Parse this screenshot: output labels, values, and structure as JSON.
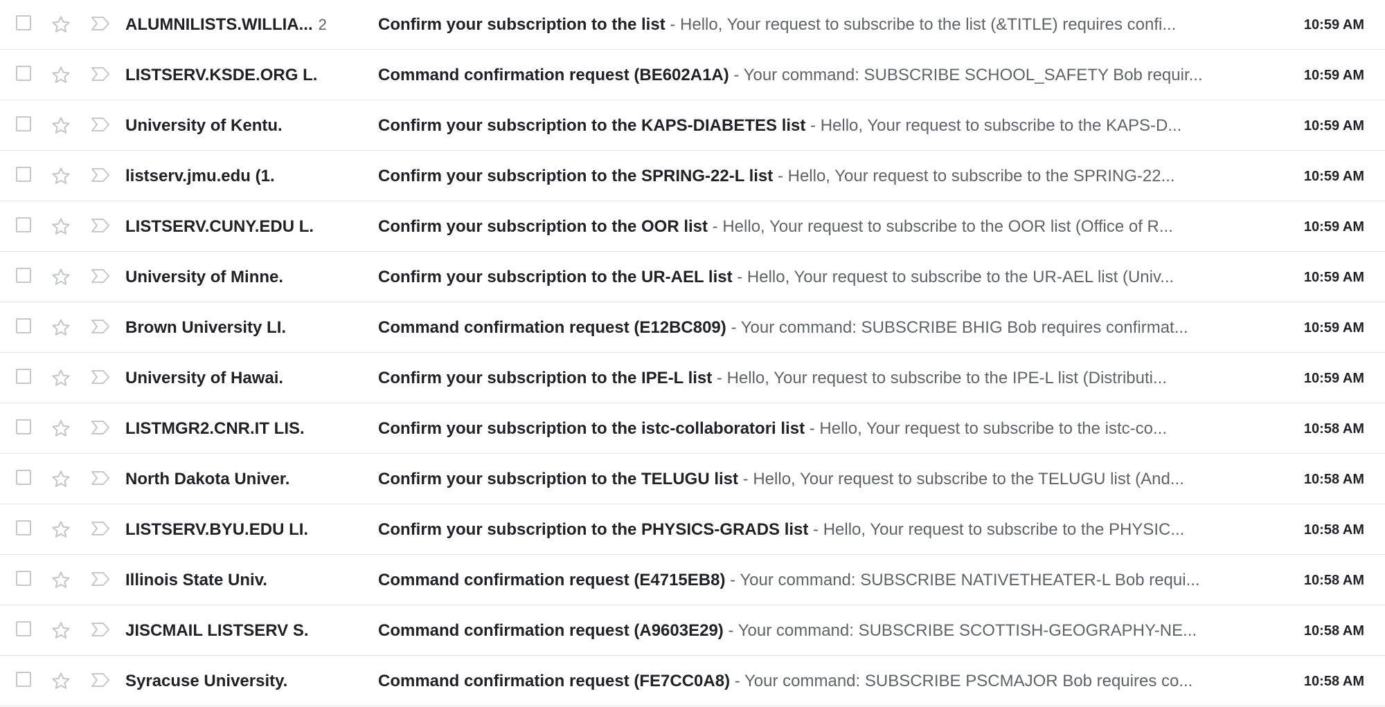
{
  "colors": {
    "text_primary": "#202124",
    "text_secondary": "#5f6368",
    "divider": "#e3e4e6",
    "icon_outline": "#c4c7cc"
  },
  "icons": {
    "checkbox": "checkbox-icon",
    "star": "star-icon",
    "important": "important-marker-icon"
  },
  "separator": " - ",
  "emails": [
    {
      "sender": "ALUMNILISTS.WILLIA...",
      "count": "2",
      "subject": "Confirm your subscription to the list",
      "snippet": "Hello, Your request to subscribe to the list (&TITLE) requires confi...",
      "time": "10:59 AM"
    },
    {
      "sender": "LISTSERV.KSDE.ORG L.",
      "count": "",
      "subject": "Command confirmation request (BE602A1A)",
      "snippet": "Your command: SUBSCRIBE SCHOOL_SAFETY Bob requir...",
      "time": "10:59 AM"
    },
    {
      "sender": "University of Kentu.",
      "count": "",
      "subject": "Confirm your subscription to the KAPS-DIABETES list",
      "snippet": "Hello, Your request to subscribe to the KAPS-D...",
      "time": "10:59 AM"
    },
    {
      "sender": "listserv.jmu.edu (1.",
      "count": "",
      "subject": "Confirm your subscription to the SPRING-22-L list",
      "snippet": "Hello, Your request to subscribe to the SPRING-22...",
      "time": "10:59 AM"
    },
    {
      "sender": "LISTSERV.CUNY.EDU L.",
      "count": "",
      "subject": "Confirm your subscription to the OOR list",
      "snippet": "Hello, Your request to subscribe to the OOR list (Office of R...",
      "time": "10:59 AM"
    },
    {
      "sender": "University of Minne.",
      "count": "",
      "subject": "Confirm your subscription to the UR-AEL list",
      "snippet": "Hello, Your request to subscribe to the UR-AEL list (Univ...",
      "time": "10:59 AM"
    },
    {
      "sender": "Brown University LI.",
      "count": "",
      "subject": "Command confirmation request (E12BC809)",
      "snippet": "Your command: SUBSCRIBE BHIG Bob requires confirmat...",
      "time": "10:59 AM"
    },
    {
      "sender": "University of Hawai.",
      "count": "",
      "subject": "Confirm your subscription to the IPE-L list",
      "snippet": "Hello, Your request to subscribe to the IPE-L list (Distributi...",
      "time": "10:59 AM"
    },
    {
      "sender": "LISTMGR2.CNR.IT LIS.",
      "count": "",
      "subject": "Confirm your subscription to the istc-collaboratori list",
      "snippet": "Hello, Your request to subscribe to the istc-co...",
      "time": "10:58 AM"
    },
    {
      "sender": "North Dakota Univer.",
      "count": "",
      "subject": "Confirm your subscription to the TELUGU list",
      "snippet": "Hello, Your request to subscribe to the TELUGU list (And...",
      "time": "10:58 AM"
    },
    {
      "sender": "LISTSERV.BYU.EDU LI.",
      "count": "",
      "subject": "Confirm your subscription to the PHYSICS-GRADS list",
      "snippet": "Hello, Your request to subscribe to the PHYSIC...",
      "time": "10:58 AM"
    },
    {
      "sender": "Illinois State Univ.",
      "count": "",
      "subject": "Command confirmation request (E4715EB8)",
      "snippet": "Your command: SUBSCRIBE NATIVETHEATER-L Bob requi...",
      "time": "10:58 AM"
    },
    {
      "sender": "JISCMAIL LISTSERV S.",
      "count": "",
      "subject": "Command confirmation request (A9603E29)",
      "snippet": "Your command: SUBSCRIBE SCOTTISH-GEOGRAPHY-NE...",
      "time": "10:58 AM"
    },
    {
      "sender": "Syracuse University.",
      "count": "",
      "subject": "Command confirmation request (FE7CC0A8)",
      "snippet": "Your command: SUBSCRIBE PSCMAJOR Bob requires co...",
      "time": "10:58 AM"
    }
  ]
}
